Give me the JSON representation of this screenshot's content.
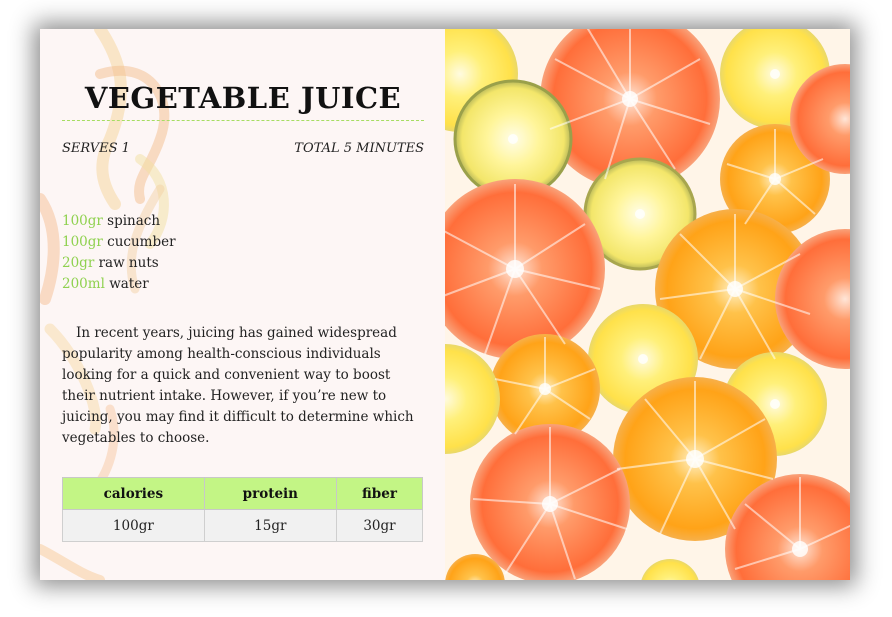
{
  "recipe": {
    "title": "VEGETABLE JUICE",
    "serves": "SERVES 1",
    "total_time": "TOTAL 5 MINUTES",
    "ingredients": [
      {
        "qty": "100gr",
        "name": "spinach"
      },
      {
        "qty": "100gr",
        "name": "cucumber"
      },
      {
        "qty": "20gr",
        "name": "raw nuts"
      },
      {
        "qty": "200ml",
        "name": "water"
      }
    ],
    "description": "In recent years, juicing has gained widespread popularity among health-conscious individuals looking for a quick and convenient way to boost their nutrient intake. However, if you’re new to juicing, you may find it difficult to determine which vegetables to choose.",
    "nutrition": {
      "headers": [
        "calories",
        "protein",
        "fiber"
      ],
      "values": [
        "100gr",
        "15gr",
        "30gr"
      ]
    }
  },
  "colors": {
    "accent_green": "#8fd14f",
    "table_header": "#c3f585",
    "card_background": "#fdf6f5"
  },
  "image": {
    "description_icon": "citrus-slices-photo"
  }
}
